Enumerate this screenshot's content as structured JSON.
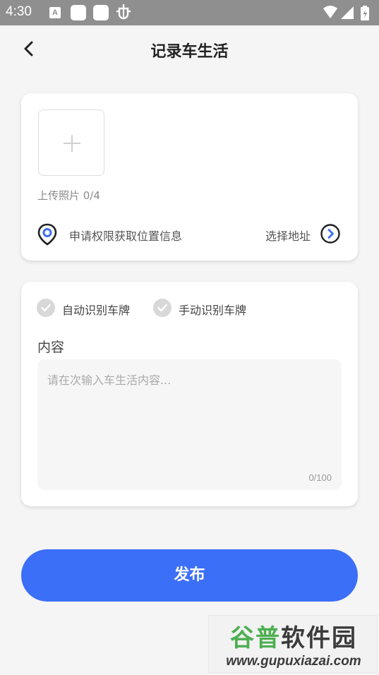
{
  "status_bar": {
    "time": "4:30",
    "notification_icons": [
      "a-badge-icon",
      "square-icon",
      "square-icon",
      "bug-icon"
    ],
    "system_icons": [
      "wifi-icon",
      "signal-icon",
      "battery-icon"
    ]
  },
  "header": {
    "title": "记录车生活",
    "back_icon": "chevron-left-icon"
  },
  "upload": {
    "label": "上传照片 0/4",
    "add_icon": "plus-icon"
  },
  "location": {
    "prompt": "申请权限获取位置信息",
    "select_label": "选择地址",
    "pin_icon": "location-pin-icon",
    "arrow_icon": "chevron-right-circle-icon"
  },
  "plate_options": [
    {
      "label": "自动识别车牌",
      "checked": false
    },
    {
      "label": "手动识别车牌",
      "checked": false
    }
  ],
  "content": {
    "label": "内容",
    "placeholder": "请在次输入车生活内容...",
    "value": "",
    "counter": "0/100"
  },
  "publish": {
    "label": "发布"
  },
  "watermark": {
    "title_part1": "谷普",
    "title_part2": "软件园",
    "url": "www.gupuxiazai.com"
  },
  "colors": {
    "accent": "#3c6ff7",
    "status_bar": "#8f8f8f",
    "background": "#f5f5f5",
    "card": "#ffffff"
  }
}
